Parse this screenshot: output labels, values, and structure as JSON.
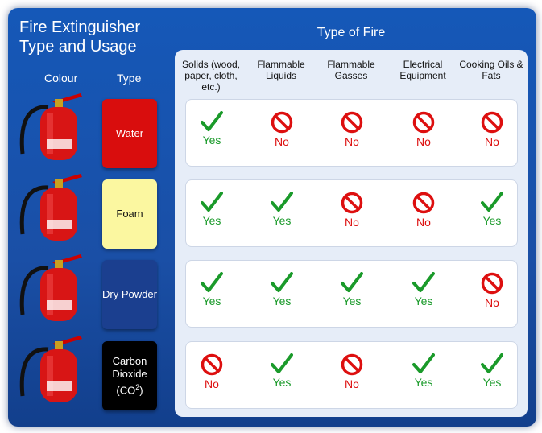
{
  "title": "Fire Extinguisher Type and Usage",
  "headers": {
    "colour": "Colour",
    "type": "Type",
    "type_of_fire": "Type of Fire"
  },
  "fire_types": [
    "Solids (wood, paper, cloth, etc.)",
    "Flammable Liquids",
    "Flammable Gasses",
    "Electrical Equipment",
    "Cooking Oils & Fats"
  ],
  "rows": [
    {
      "type": "Water",
      "bg": "#d90d0d",
      "fg": "#ffffff",
      "cells": [
        "Yes",
        "No",
        "No",
        "No",
        "No"
      ]
    },
    {
      "type": "Foam",
      "bg": "#fbf7a0",
      "fg": "#111111",
      "cells": [
        "Yes",
        "Yes",
        "No",
        "No",
        "Yes"
      ]
    },
    {
      "type": "Dry Powder",
      "bg": "#1b3f8f",
      "fg": "#ffffff",
      "cells": [
        "Yes",
        "Yes",
        "Yes",
        "Yes",
        "No"
      ]
    },
    {
      "type": "Carbon Dioxide (CO",
      "type_sup": "2",
      "type_end": ")",
      "bg": "#000000",
      "fg": "#ffffff",
      "cells": [
        "No",
        "Yes",
        "No",
        "Yes",
        "Yes"
      ]
    }
  ],
  "colors": {
    "yes": "#1a9a2a",
    "no": "#dd0f0f",
    "extinguisher": "#d81515"
  }
}
